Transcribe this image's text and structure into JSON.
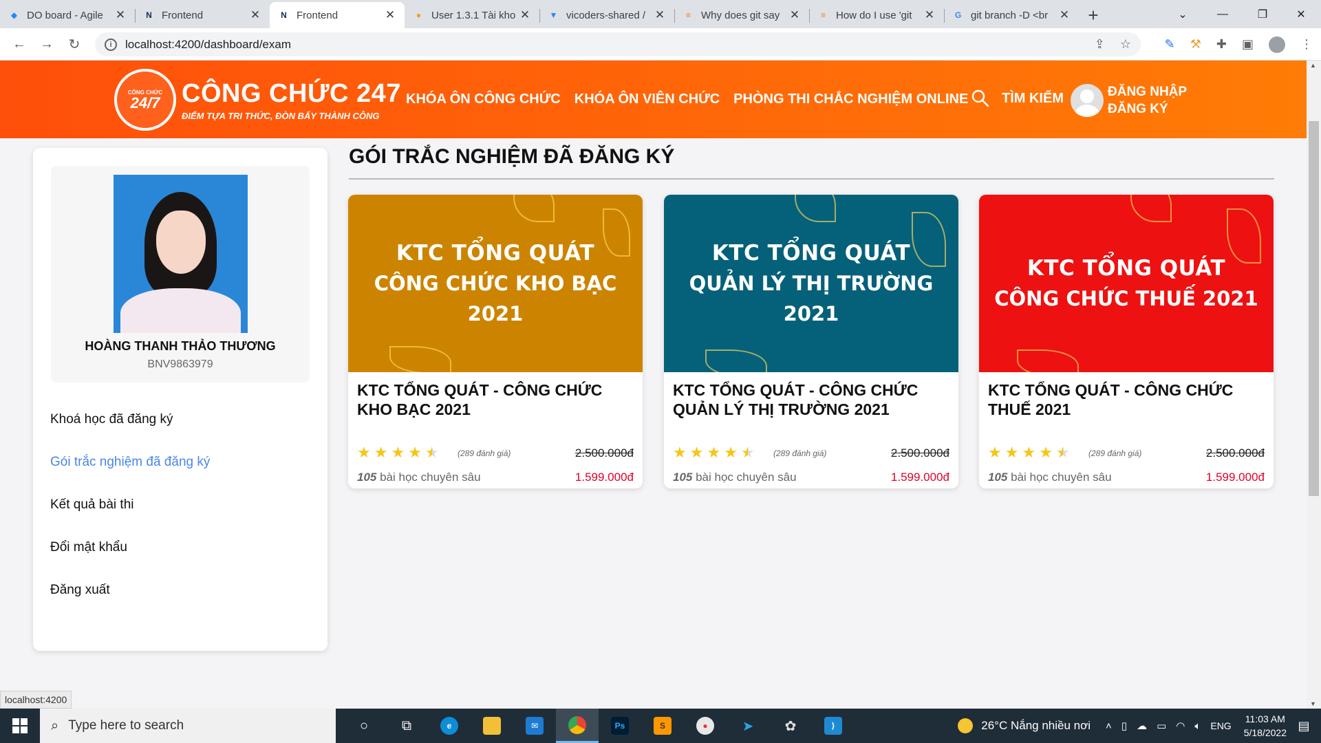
{
  "browser": {
    "tabs": [
      {
        "title": "DO board - Agile",
        "icon": "jira-icon",
        "active": false
      },
      {
        "title": "Frontend",
        "icon": "nx-icon",
        "active": false
      },
      {
        "title": "Frontend",
        "icon": "nx-icon",
        "active": true
      },
      {
        "title": "User 1.3.1 Tài kho",
        "icon": "app-icon",
        "active": false
      },
      {
        "title": "vicoders-shared /",
        "icon": "bitbucket-icon",
        "active": false
      },
      {
        "title": "Why does git say",
        "icon": "stackoverflow-icon",
        "active": false
      },
      {
        "title": "How do I use 'git",
        "icon": "stackoverflow-icon",
        "active": false
      },
      {
        "title": "git branch -D <br",
        "icon": "google-icon",
        "active": false
      }
    ],
    "url": "localhost:4200/dashboard/exam",
    "status_url": "localhost:4200"
  },
  "site": {
    "logo": {
      "small": "CÔNG CHỨC",
      "badge": "24/7",
      "title": "CÔNG CHỨC 247",
      "slogan": "ĐIỂM TỰA TRI THỨC, ĐÒN BẨY THÀNH CÔNG"
    },
    "nav": [
      "KHÓA ÔN CÔNG CHỨC",
      "KHÓA ÔN VIÊN CHỨC",
      "PHÒNG THI CHẮC NGHIỆM ONLINE"
    ],
    "search_label": "TÌM KIẾM",
    "login_label": "ĐĂNG NHẬP",
    "register_label": "ĐĂNG KÝ"
  },
  "profile": {
    "name": "HOÀNG THANH THẢO THƯƠNG",
    "id": "BNV9863979"
  },
  "side_menu": [
    {
      "label": "Khoá học đã đăng ký",
      "active": false
    },
    {
      "label": "Gói trắc nghiệm đã đăng ký",
      "active": true
    },
    {
      "label": "Kết quả bài thi",
      "active": false
    },
    {
      "label": "Đổi mật khẩu",
      "active": false
    },
    {
      "label": "Đăng xuất",
      "active": false
    }
  ],
  "main": {
    "section_title": "GÓI TRẮC NGHIỆM ĐÃ ĐĂNG KÝ",
    "cards": [
      {
        "banner_line1": "KTC TỔNG QUÁT",
        "banner_line2": "CÔNG CHỨC KHO BẠC 2021",
        "banner_color": "#cc8400",
        "title": "KTC TỔNG QUÁT - CÔNG CHỨC KHO BẠC 2021",
        "rating": 4.5,
        "reviews": "(289 đánh giá)",
        "old_price": "2.500.000đ",
        "lesson_count": "105",
        "lesson_text": " bài học chuyên sâu",
        "new_price": "1.599.000đ"
      },
      {
        "banner_line1": "KTC TỔNG QUÁT",
        "banner_line2": "QUẢN LÝ THỊ TRƯỜNG 2021",
        "banner_color": "#05617a",
        "title": "KTC TỔNG QUÁT - CÔNG CHỨC QUẢN LÝ THỊ TRƯỜNG 2021",
        "rating": 4.5,
        "reviews": "(289 đánh giá)",
        "old_price": "2.500.000đ",
        "lesson_count": "105",
        "lesson_text": " bài học chuyên sâu",
        "new_price": "1.599.000đ"
      },
      {
        "banner_line1": "KTC TỔNG QUÁT",
        "banner_line2": "CÔNG CHỨC THUẾ 2021",
        "banner_color": "#ee1111",
        "title": "KTC TỔNG QUÁT - CÔNG CHỨC THUẾ 2021",
        "rating": 4.5,
        "reviews": "(289 đánh giá)",
        "old_price": "2.500.000đ",
        "lesson_count": "105",
        "lesson_text": " bài học chuyên sâu",
        "new_price": "1.599.000đ"
      }
    ]
  },
  "taskbar": {
    "search_placeholder": "Type here to search",
    "weather": "26°C  Nắng nhiều nơi",
    "language": "ENG",
    "time": "11:03 AM",
    "date": "5/18/2022",
    "apps": [
      "cortana-icon",
      "task-view-icon",
      "edge-icon",
      "file-explorer-icon",
      "mail-icon",
      "chrome-icon",
      "photoshop-icon",
      "sublime-text-icon",
      "chat-icon",
      "telegram-icon",
      "paint-icon",
      "vscode-icon"
    ]
  },
  "colors": {
    "header_start": "#ff4f0a",
    "header_end": "#ff7c06",
    "active_menu": "#4a86e8",
    "price_red": "#e0002a",
    "star": "#f5c518"
  }
}
